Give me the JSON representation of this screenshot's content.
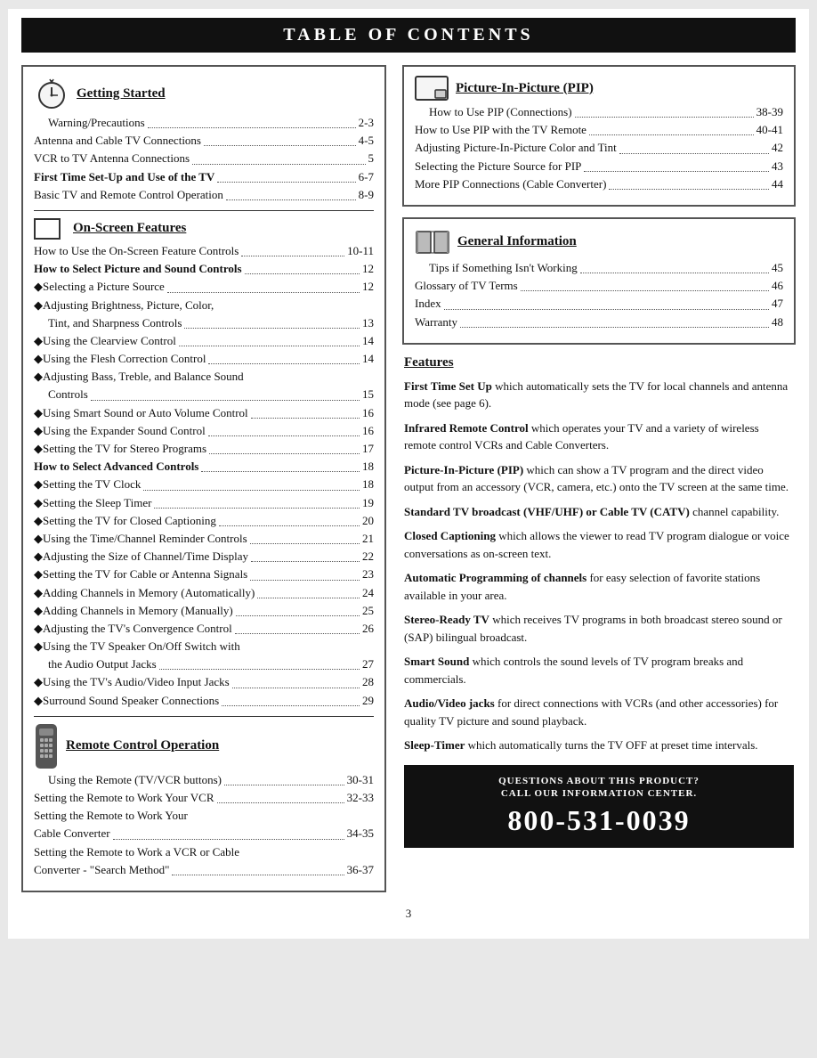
{
  "header": {
    "title": "Table of Contents"
  },
  "left": {
    "sections": [
      {
        "id": "getting-started",
        "title": "Getting Started",
        "icon": "clock",
        "items": [
          {
            "label": "Warning/Precautions",
            "page": "2-3",
            "indent": 2
          },
          {
            "label": "Antenna and Cable TV Connections",
            "page": "4-5",
            "indent": 0
          },
          {
            "label": "VCR to TV Antenna Connections",
            "page": "5",
            "indent": 0
          },
          {
            "label": "First Time Set-Up and Use of the TV",
            "page": "6-7",
            "bold": true,
            "indent": 0
          },
          {
            "label": "Basic TV and Remote Control Operation",
            "page": "8-9",
            "indent": 0
          }
        ]
      },
      {
        "id": "on-screen",
        "title": "On-Screen Features",
        "icon": "square",
        "items": [
          {
            "label": "How to Use the On-Screen Feature Controls",
            "page": "10-11",
            "indent": 0
          },
          {
            "label": "How to Select Picture and Sound Controls",
            "page": "12",
            "bold": true,
            "indent": 0
          },
          {
            "label": "◆Selecting a Picture Source",
            "page": "12",
            "indent": 0
          },
          {
            "label": "◆Adjusting Brightness, Picture, Color,",
            "page": "",
            "indent": 0
          },
          {
            "label": "    Tint, and Sharpness Controls",
            "page": "13",
            "indent": 0
          },
          {
            "label": "◆Using the Clearview Control",
            "page": "14",
            "indent": 0
          },
          {
            "label": "◆Using the Flesh Correction Control",
            "page": "14",
            "indent": 0
          },
          {
            "label": "◆Adjusting Bass, Treble, and Balance Sound",
            "page": "",
            "indent": 0
          },
          {
            "label": "Controls",
            "page": "15",
            "indent": 0
          },
          {
            "label": "◆Using Smart Sound or Auto Volume Control",
            "page": "16",
            "indent": 0
          },
          {
            "label": "◆Using the Expander Sound Control",
            "page": "16",
            "indent": 0
          },
          {
            "label": "◆Setting the TV for Stereo Programs",
            "page": "17",
            "indent": 0
          },
          {
            "label": "How to Select Advanced Controls",
            "page": "18",
            "bold": true,
            "indent": 0
          },
          {
            "label": "◆Setting the TV Clock",
            "page": "18",
            "indent": 0
          },
          {
            "label": "◆Setting the Sleep Timer",
            "page": "19",
            "indent": 0
          },
          {
            "label": "◆Setting the TV for Closed Captioning",
            "page": "20",
            "indent": 0
          },
          {
            "label": "◆Using the Time/Channel Reminder Controls",
            "page": "21",
            "indent": 0
          },
          {
            "label": "◆Adjusting the Size of Channel/Time Display",
            "page": "22",
            "indent": 0
          },
          {
            "label": "◆Setting the TV for Cable or Antenna Signals",
            "page": "23",
            "indent": 0
          },
          {
            "label": "◆Adding Channels in Memory (Automatically)",
            "page": "24",
            "indent": 0
          },
          {
            "label": "◆Adding Channels in Memory (Manually)",
            "page": "25",
            "indent": 0
          },
          {
            "label": "◆Adjusting the TV's Convergence Control",
            "page": "26",
            "indent": 0
          },
          {
            "label": "◆Using the TV Speaker On/Off Switch with",
            "page": "",
            "indent": 0
          },
          {
            "label": "    the Audio Output Jacks",
            "page": "27",
            "indent": 0
          },
          {
            "label": "◆Using the TV's Audio/Video Input Jacks",
            "page": "28",
            "indent": 0
          },
          {
            "label": "◆Surround Sound Speaker Connections",
            "page": "29",
            "indent": 0
          }
        ]
      },
      {
        "id": "remote",
        "title": "Remote Control Operation",
        "icon": "remote",
        "items": [
          {
            "label": "Using the Remote (TV/VCR buttons)",
            "page": "30-31",
            "indent": 2
          },
          {
            "label": "Setting the Remote to Work Your VCR",
            "page": "32-33",
            "indent": 0
          },
          {
            "label": "Setting the Remote to Work Your",
            "page": "",
            "indent": 0
          },
          {
            "label": "Cable Converter",
            "page": "34-35",
            "indent": 0
          },
          {
            "label": "Setting the Remote to Work a VCR or Cable",
            "page": "",
            "indent": 0
          },
          {
            "label": "Converter - \"Search Method\"",
            "page": "36-37",
            "indent": 0
          }
        ]
      }
    ]
  },
  "right": {
    "pip": {
      "title": "Picture-In-Picture (PIP)",
      "items": [
        {
          "label": "How to Use PIP (Connections)",
          "page": "38-39",
          "indent": 2
        },
        {
          "label": "How to Use PIP with the TV Remote",
          "page": "40-41",
          "indent": 0
        },
        {
          "label": "Adjusting Picture-In-Picture Color and Tint",
          "page": "42",
          "indent": 0
        },
        {
          "label": "Selecting the Picture Source for PIP",
          "page": "43",
          "indent": 0
        },
        {
          "label": "More PIP Connections (Cable Converter)",
          "page": "44",
          "indent": 0
        }
      ]
    },
    "general": {
      "title": "General Information",
      "items": [
        {
          "label": "Tips if Something Isn't Working",
          "page": "45",
          "indent": 2
        },
        {
          "label": "Glossary of TV Terms",
          "page": "46",
          "indent": 0
        },
        {
          "label": "Index",
          "page": "47",
          "indent": 0
        },
        {
          "label": "Warranty",
          "page": "48",
          "indent": 0
        }
      ]
    },
    "features": {
      "title": "Features",
      "items": [
        {
          "bold_part": "First Time Set Up",
          "normal_part": " which automatically sets the TV for local channels and antenna mode (see page 6)."
        },
        {
          "bold_part": "Infrared Remote Control",
          "normal_part": " which operates your TV and a variety of wireless remote control VCRs and Cable Converters."
        },
        {
          "bold_part": "Picture-In-Picture (PIP)",
          "normal_part": " which can show a TV program and the direct video output from an accessory (VCR, camera, etc.) onto the TV screen at the same time."
        },
        {
          "bold_part": "Standard TV broadcast (VHF/UHF) or Cable TV (CATV)",
          "normal_part": " channel capability."
        },
        {
          "bold_part": "Closed Captioning",
          "normal_part": " which allows the viewer to read TV program dialogue or voice conversations as on-screen text."
        },
        {
          "bold_part": "Automatic Programming of channels",
          "normal_part": " for  easy selection of favorite stations available in your area."
        },
        {
          "bold_part": "Stereo-Ready TV",
          "normal_part": "which receives TV programs in both broadcast stereo sound or (SAP) bilingual broadcast."
        },
        {
          "bold_part": "Smart Sound",
          "normal_part": " which controls the sound levels of TV program breaks and commercials."
        },
        {
          "bold_part": "Audio/Video jacks",
          "normal_part": " for direct connections with VCRs (and other accessories) for quality TV picture and sound playback."
        },
        {
          "bold_part": "Sleep-Timer",
          "normal_part": " which automatically turns the TV OFF at preset time intervals."
        }
      ]
    },
    "info_center": {
      "line1": "Questions About This Product?",
      "line2": "Call Our Information Center.",
      "phone": "800-531-0039"
    }
  },
  "footer": {
    "page_number": "3"
  }
}
